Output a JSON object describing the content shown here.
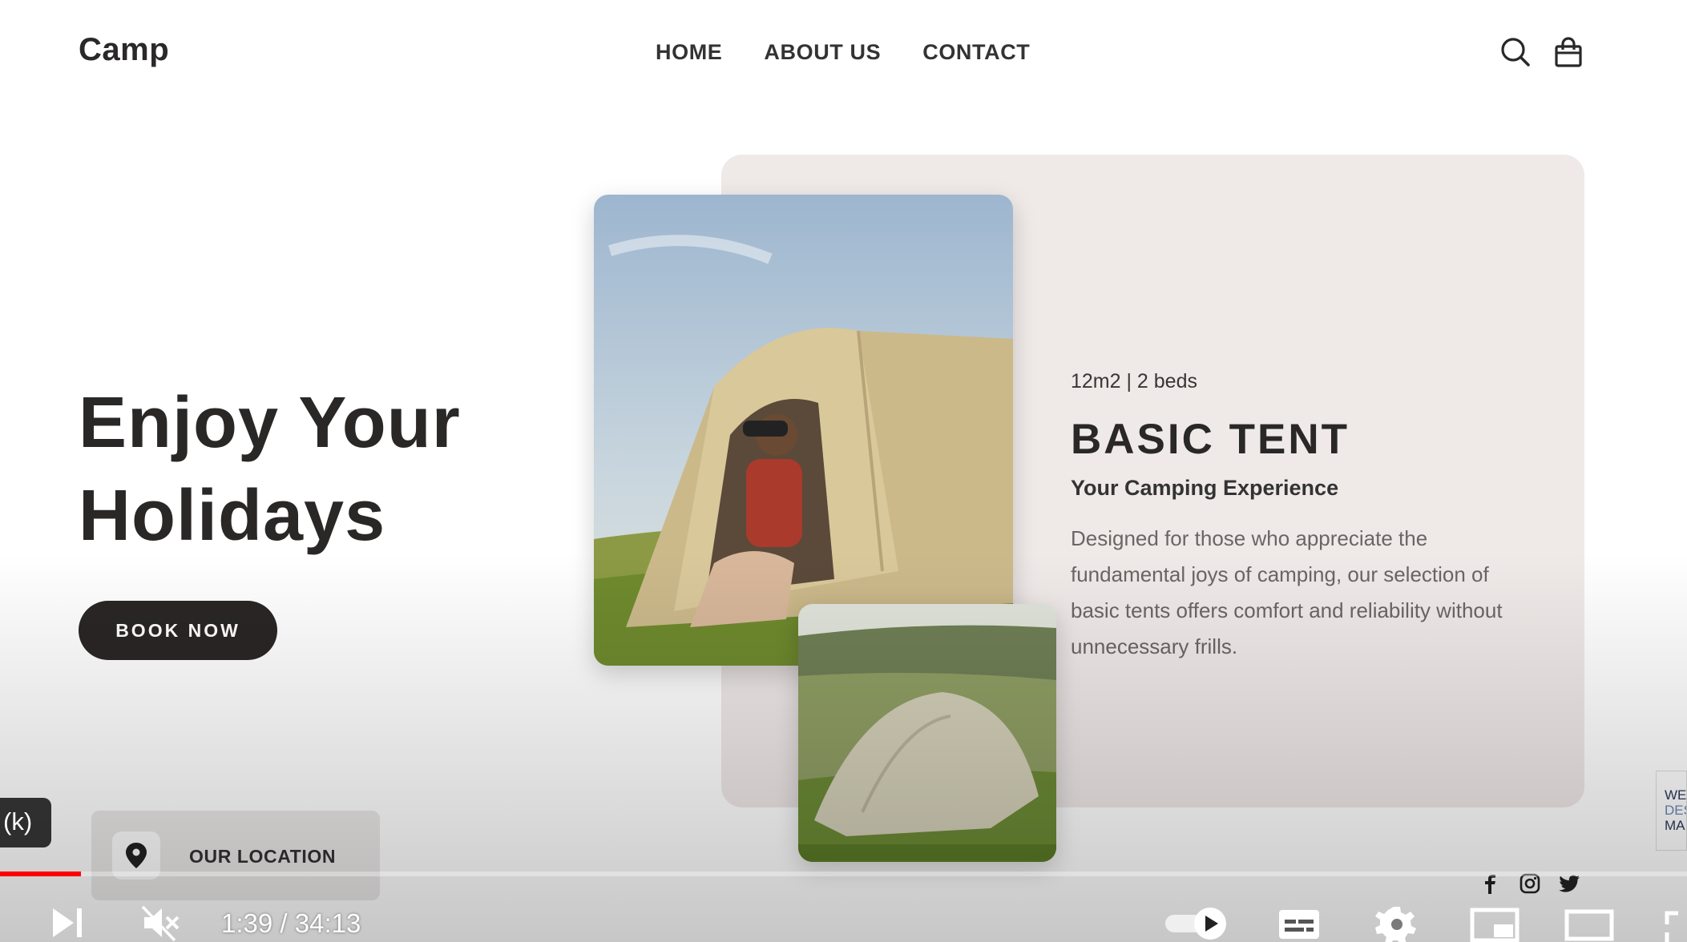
{
  "header": {
    "brand": "Camp",
    "nav": [
      "HOME",
      "ABOUT US",
      "CONTACT"
    ],
    "icons": [
      "search-icon",
      "shopping-bag-icon"
    ]
  },
  "hero": {
    "title_line1": "Enjoy Your",
    "title_line2": "Holidays",
    "cta": "BOOK NOW"
  },
  "product": {
    "specs": "12m2 | 2 beds",
    "title": "BASIC TENT",
    "subtitle": "Your Camping Experience",
    "description": "Designed for those who appreciate the fundamental joys of camping, our selection of basic tents offers comfort and reliability without unnecessary frills."
  },
  "location": {
    "label": "OUR LOCATION",
    "icon": "map-pin-icon"
  },
  "social": [
    "facebook-icon",
    "instagram-icon",
    "twitter-icon"
  ],
  "side_badge": [
    "WE",
    "DES",
    "MA"
  ],
  "player": {
    "shortcut_badge": "(k)",
    "time": "1:39 / 34:13",
    "progress_fraction": 0.048,
    "accent_color": "#ff0000",
    "controls": [
      "next-icon",
      "mute-icon",
      "autoplay-toggle",
      "subtitles-icon",
      "settings-icon",
      "miniplayer-icon",
      "theater-icon",
      "fullscreen-icon"
    ]
  },
  "colors": {
    "text_dark": "#2a2727",
    "button_bg": "#2a2626",
    "card_bg": "#efe9e8"
  }
}
